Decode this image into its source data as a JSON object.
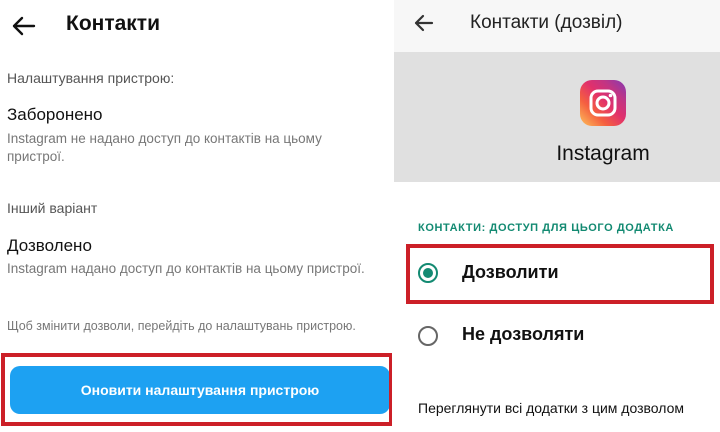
{
  "left": {
    "title": "Контакти",
    "device_settings_label": "Налаштування пристрою:",
    "option_denied": {
      "title": "Заборонено",
      "description": "Instagram не надано доступ до контактів на цьому пристрої."
    },
    "other_option_label": "Інший варіант",
    "option_allowed": {
      "title": "Дозволено",
      "description": "Instagram надано доступ до контактів на цьому пристрої."
    },
    "hint": "Щоб змінити дозволи, перейдіть до налаштувань пристрою.",
    "update_button": "Оновити налаштування пристрою"
  },
  "right": {
    "title": "Контакти (дозвіл)",
    "app_name": "Instagram",
    "app_icon": "instagram-logo-icon",
    "permission_heading": "КОНТАКТИ: ДОСТУП ДЛЯ ЦЬОГО ДОДАТКА",
    "options": [
      {
        "label": "Дозволити",
        "selected": true
      },
      {
        "label": "Не дозволяти",
        "selected": false
      }
    ],
    "see_all_link": "Переглянути всі додатки з цим дозволом"
  },
  "colors": {
    "accent_button": "#1da1f2",
    "radio_selected": "#138a72",
    "highlight_box": "#cc1f27"
  }
}
